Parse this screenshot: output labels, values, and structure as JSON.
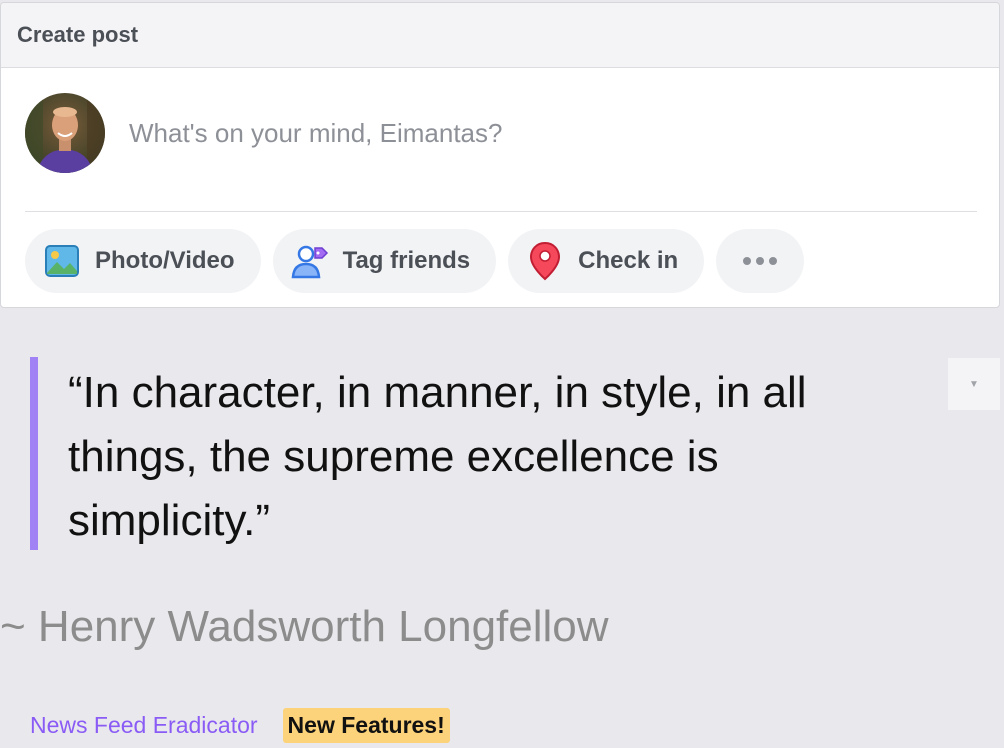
{
  "post_card": {
    "title": "Create post",
    "placeholder": "What's on your mind, Eimantas?",
    "avatar_icon": "user-avatar-icon",
    "actions": [
      {
        "label": "Photo/Video",
        "icon": "photo-video-icon"
      },
      {
        "label": "Tag friends",
        "icon": "tag-friends-icon"
      },
      {
        "label": "Check in",
        "icon": "location-pin-icon"
      }
    ],
    "more_icon": "more-dots-icon"
  },
  "quote": {
    "text": "“In character, in manner, in style, in all things, the supreme excellence is simplicity.”",
    "author": "~ Henry Wadsworth Longfellow",
    "dropdown_icon": "chevron-down-icon",
    "accent_color": "#a082f5"
  },
  "footer": {
    "link_label": "News Feed Eradicator",
    "badge_label": "New Features!"
  }
}
